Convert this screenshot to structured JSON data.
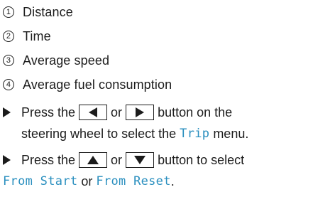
{
  "legend": {
    "items": [
      {
        "number": "1",
        "label": "Distance"
      },
      {
        "number": "2",
        "label": "Time"
      },
      {
        "number": "3",
        "label": "Average speed"
      },
      {
        "number": "4",
        "label": "Average fuel consumption"
      }
    ]
  },
  "steps": {
    "step1": {
      "line1_prefix": "Press the",
      "connector": "or",
      "line1_suffix": "button on the",
      "line2_prefix": "steering wheel to select the",
      "menu_name": "Trip",
      "line2_suffix": "menu."
    },
    "step2": {
      "line1_prefix": "Press the",
      "connector": "or",
      "line1_suffix": "button to select",
      "option1": "From Start",
      "joiner": "or",
      "option2": "From Reset",
      "end": "."
    }
  },
  "icons": {
    "bullet": "right-triangle-bullet",
    "left_button": "left-arrow-icon",
    "right_button": "right-arrow-icon",
    "up_button": "up-arrow-icon",
    "down_button": "down-arrow-icon"
  },
  "colors": {
    "text": "#1c1c1c",
    "display_text": "#2a8fbf"
  }
}
